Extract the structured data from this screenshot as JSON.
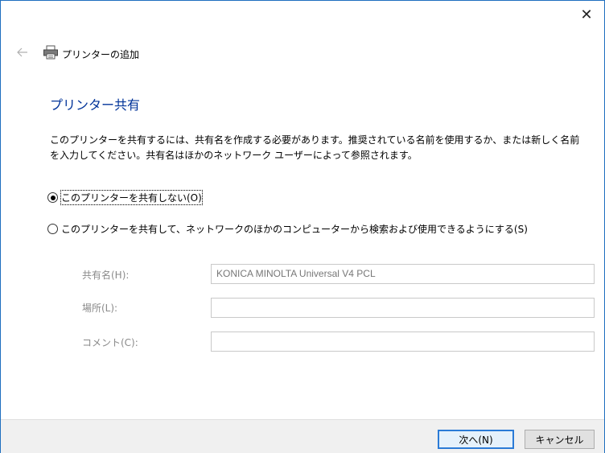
{
  "window": {
    "title": "プリンターの追加",
    "close_glyph": "✕"
  },
  "page": {
    "heading": "プリンター共有",
    "description": "このプリンターを共有するには、共有名を作成する必要があります。推奨されている名前を使用するか、または新しく名前を入力してください。共有名はほかのネットワーク ユーザーによって参照されます。"
  },
  "options": {
    "no_share_label": "このプリンターを共有しない(O)",
    "no_share_selected": true,
    "share_label": "このプリンターを共有して、ネットワークのほかのコンピューターから検索および使用できるようにする(S)",
    "share_selected": false
  },
  "fields": {
    "share_name_label": "共有名(H):",
    "share_name_value": "KONICA MINOLTA Universal V4 PCL",
    "location_label": "場所(L):",
    "location_value": "",
    "comment_label": "コメント(C):",
    "comment_value": ""
  },
  "buttons": {
    "next_label": "次へ(N)",
    "cancel_label": "キャンセル"
  },
  "colors": {
    "heading": "#003399",
    "default_button_border": "#2b7bd6",
    "disabled_text": "#8a8a8a"
  }
}
